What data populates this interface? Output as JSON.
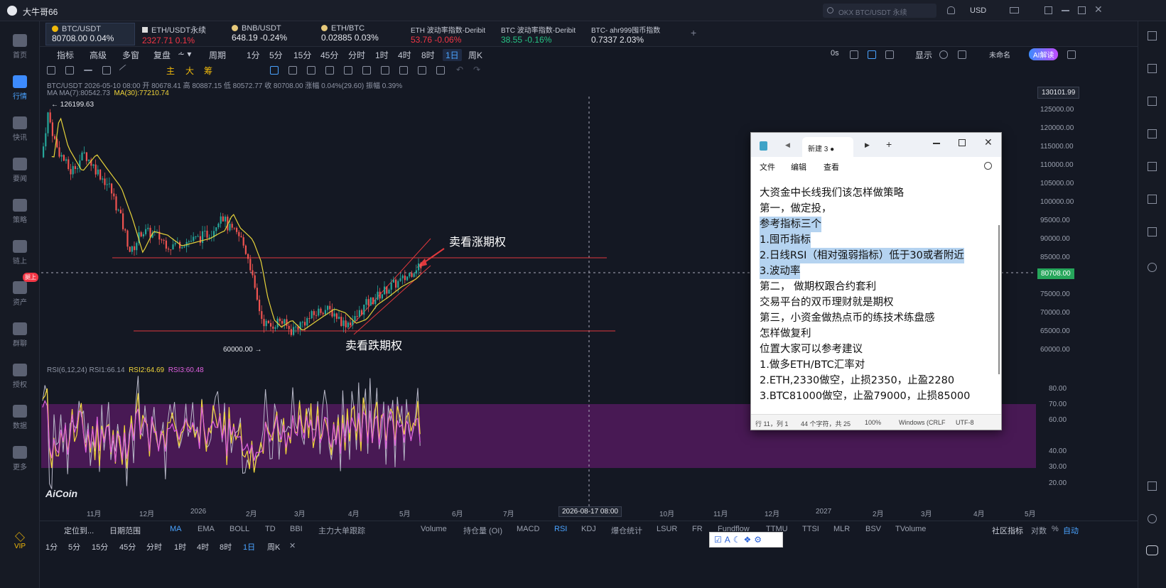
{
  "app": {
    "title": "大牛哥66",
    "search_placeholder": "OKX BTC/USDT 永续",
    "currency": "USD"
  },
  "sidebar": {
    "items": [
      {
        "label": "首页",
        "icon": "home-icon"
      },
      {
        "label": "行情",
        "icon": "market-icon"
      },
      {
        "label": "快讯",
        "icon": "flash-news-icon"
      },
      {
        "label": "要闻",
        "icon": "news-icon"
      },
      {
        "label": "策略",
        "icon": "strategy-icon"
      },
      {
        "label": "链上",
        "icon": "onchain-icon"
      },
      {
        "label": "资产",
        "icon": "wallet-icon",
        "badge": "腿上"
      },
      {
        "label": "群聊",
        "icon": "chat-icon"
      },
      {
        "label": "授权",
        "icon": "authorize-icon"
      },
      {
        "label": "数据",
        "icon": "data-icon"
      },
      {
        "label": "更多",
        "icon": "more-icon"
      }
    ],
    "vip": "VIP"
  },
  "tickers": [
    {
      "name": "BTC/USDT",
      "price": "80708.00",
      "change": "0.04%",
      "dir": "up"
    },
    {
      "name": "ETH/USDT永续",
      "price": "2327.71",
      "change": "0.1%",
      "dir": "dn"
    },
    {
      "name": "BNB/USDT",
      "price": "648.19",
      "change": "-0.24%",
      "dir": "wh"
    },
    {
      "name": "ETH/BTC",
      "price": "0.02885",
      "change": "0.03%",
      "dir": "wh"
    },
    {
      "name": "ETH 波动率指数-Deribit",
      "price": "53.76",
      "change": "-0.06%",
      "dir": "dn"
    },
    {
      "name": "BTC 波动率指数-Deribit",
      "price": "38.55",
      "change": "-0.16%",
      "dir": "up"
    },
    {
      "name": "BTC- ahr999囤币指数",
      "price": "0.7337",
      "change": "2.03%",
      "dir": "wh"
    }
  ],
  "toolbar": {
    "items": [
      "指标",
      "高级",
      "多窗",
      "复盘",
      "周期",
      "1分",
      "5分",
      "15分",
      "45分",
      "分时",
      "1时",
      "4时",
      "8时",
      "1日",
      "周K"
    ],
    "selected": "1日",
    "right": [
      "0s",
      "显示",
      "未命名",
      "AI解读"
    ]
  },
  "drawbar": [
    "主",
    "大",
    "筹"
  ],
  "info_line": "BTC/USDT  2026-05-10 08:00  开 80678.41  高 80887.15  低 80572.77  收 80708.00  涨幅 0.04%(29.60)  振幅 0.39%",
  "ma_line": {
    "prefix": "MA  MA(7):80542.73",
    "ma30": "MA(30):77210.74"
  },
  "rsi_line": {
    "prefix": "RSI(6,12,24)  RSI1:66.14",
    "rsi2": "RSI2:64.69",
    "rsi3": "RSI3:60.48"
  },
  "chart_data": {
    "type": "candlestick",
    "symbol": "BTC/USDT",
    "interval": "1日",
    "y_ticks": [
      "125000.00",
      "120000.00",
      "115000.00",
      "110000.00",
      "105000.00",
      "100000.00",
      "95000.00",
      "90000.00",
      "85000.00",
      "75000.00",
      "70000.00",
      "65000.00",
      "60000.00"
    ],
    "x_ticks": [
      "11月",
      "12月",
      "2026",
      "2月",
      "3月",
      "4月",
      "5月",
      "6月",
      "7月",
      "10月",
      "11月",
      "12月",
      "2027",
      "2月",
      "3月",
      "4月",
      "5月"
    ],
    "crosshair_date": "2026-08-17 08:00",
    "crosshair_price": "130101.99",
    "last_price": "80708.00",
    "high_label": "126199.63",
    "low_label": "60000.00",
    "horizontal_lines": [
      85000,
      65000
    ],
    "annotations": [
      "卖看涨期权",
      "卖看跌期权"
    ],
    "rsi_ticks": [
      "80.00",
      "70.00",
      "60.00",
      "40.00",
      "30.00",
      "20.00"
    ]
  },
  "bottom": {
    "row1": [
      "定位到...",
      "日期范围",
      "MA",
      "EMA",
      "BOLL",
      "TD",
      "BBI",
      "主力大单跟踪",
      "Volume",
      "持仓量 (OI)",
      "MACD",
      "RSI",
      "KDJ",
      "爆仓统计",
      "LSUR",
      "FR",
      "Fundflow",
      "TTMU",
      "TTSI",
      "MLR",
      "BSV",
      "TVolume",
      "社区指标",
      "对数",
      "%",
      "自动"
    ],
    "row2": [
      "1分",
      "5分",
      "15分",
      "45分",
      "分时",
      "1时",
      "4时",
      "8时",
      "1日",
      "周K"
    ]
  },
  "logo": "AiCoin",
  "notepad": {
    "tab": "新建 3",
    "menu": [
      "文件",
      "编辑",
      "查看"
    ],
    "lines": [
      "   大资金中长线我们该怎样做策略",
      "     第一，做定投，",
      "参考指标三个",
      "1.囤币指标",
      "2.日线RSI（相对强弱指标）低于30或者附近",
      "3.波动率",
      "     第二， 做期权跟合约套利",
      " 交易平台的双币理财就是期权",
      "     第三，小资金做热点币的练技术练盘感",
      "怎样做复利",
      "位置大家可以参考建议",
      "1.做多ETH/BTC汇率对",
      "2.ETH,2330做空，止损2350，止盈2280",
      "3.BTC81000做空，止盈79000，止损85000"
    ],
    "status": [
      "行 11，列 1",
      "44 个字符，共 25",
      "100%",
      "Windows (CRLF",
      "UTF-8"
    ]
  }
}
